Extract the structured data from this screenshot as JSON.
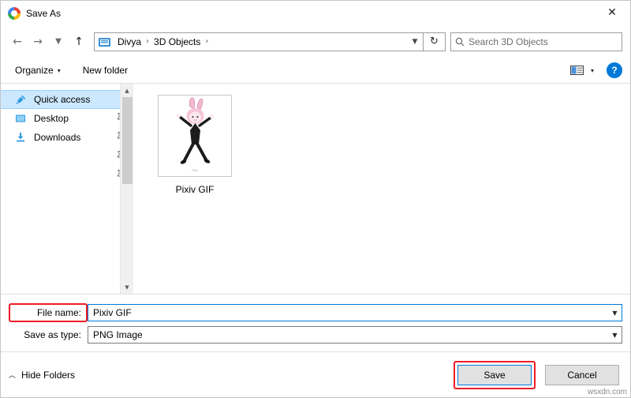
{
  "window": {
    "title": "Save As",
    "app_icon": "chrome-icon",
    "close_label": "✕"
  },
  "nav": {
    "back": "←",
    "forward": "→",
    "up": "↑",
    "refresh": "↻",
    "breadcrumbs": [
      "Divya",
      "3D Objects"
    ],
    "breadcrumb_separator": "›",
    "address_dropdown": "▼",
    "search_placeholder": "Search 3D Objects",
    "search_icon": "search-icon"
  },
  "commandbar": {
    "organize": "Organize",
    "new_folder": "New folder",
    "caret": "▾",
    "view_icon": "view-layout-icon",
    "help_label": "?"
  },
  "sidebar": {
    "items": [
      {
        "label": "Quick access",
        "icon": "star-icon",
        "selected": true,
        "pinned": false
      },
      {
        "label": "Desktop",
        "icon": "desktop-icon",
        "selected": false,
        "pinned": true
      },
      {
        "label": "Downloads",
        "icon": "download-icon",
        "selected": false,
        "pinned": true
      },
      {
        "label": "",
        "icon": "",
        "selected": false,
        "pinned": true
      },
      {
        "label": "",
        "icon": "",
        "selected": false,
        "pinned": true
      }
    ],
    "scroll_up": "▲",
    "scroll_down": "▼"
  },
  "files": [
    {
      "name": "Pixiv GIF",
      "thumb": "dancing-rabbit-character"
    }
  ],
  "form": {
    "filename_label": "File name:",
    "filename_value": "Pixiv GIF",
    "filetype_label": "Save as type:",
    "filetype_value": "PNG Image",
    "dropdown_caret": "▼"
  },
  "footer": {
    "hide_folders": "Hide Folders",
    "hide_folders_caret": "︿",
    "save": "Save",
    "cancel": "Cancel"
  },
  "watermark": "wsxdn.com",
  "colors": {
    "highlight_red": "#ee1c25",
    "selection_blue": "#cce8ff",
    "accent_blue": "#0078d7"
  }
}
